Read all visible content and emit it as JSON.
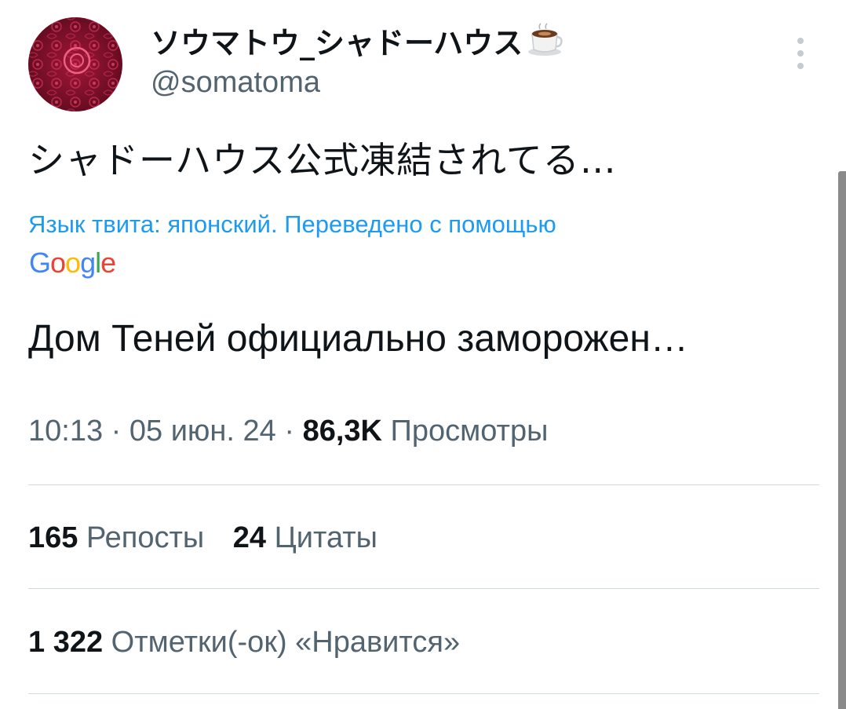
{
  "author": {
    "display_name": "ソウマトウ_シャドーハウス",
    "name_emoji_icon": "coffee-cup-icon",
    "handle": "@somatoma"
  },
  "tweet": {
    "text": "シャドーハウス公式凍結されてる…",
    "translation_note": "Язык твита: японский. Переведено с помощью",
    "translation_provider": "Google",
    "translated_text": "Дом Теней официально заморожен…"
  },
  "meta": {
    "time": "10:13",
    "separator": " · ",
    "date": "05 июн. 24",
    "views_count": "86,3K",
    "views_label": "Просмотры"
  },
  "stats": {
    "reposts_count": "165",
    "reposts_label": "Репосты",
    "quotes_count": "24",
    "quotes_label": "Цитаты",
    "likes_count": "1 322",
    "likes_label": "Отметки(-ок) «Нравится»"
  },
  "colors": {
    "text": "#0f1419",
    "secondary": "#536471",
    "link": "#1d9bf0",
    "divider": "#cfd9de",
    "google_blue": "#4285f4",
    "google_red": "#ea4335",
    "google_yellow": "#fbbc05",
    "google_green": "#34a853"
  }
}
